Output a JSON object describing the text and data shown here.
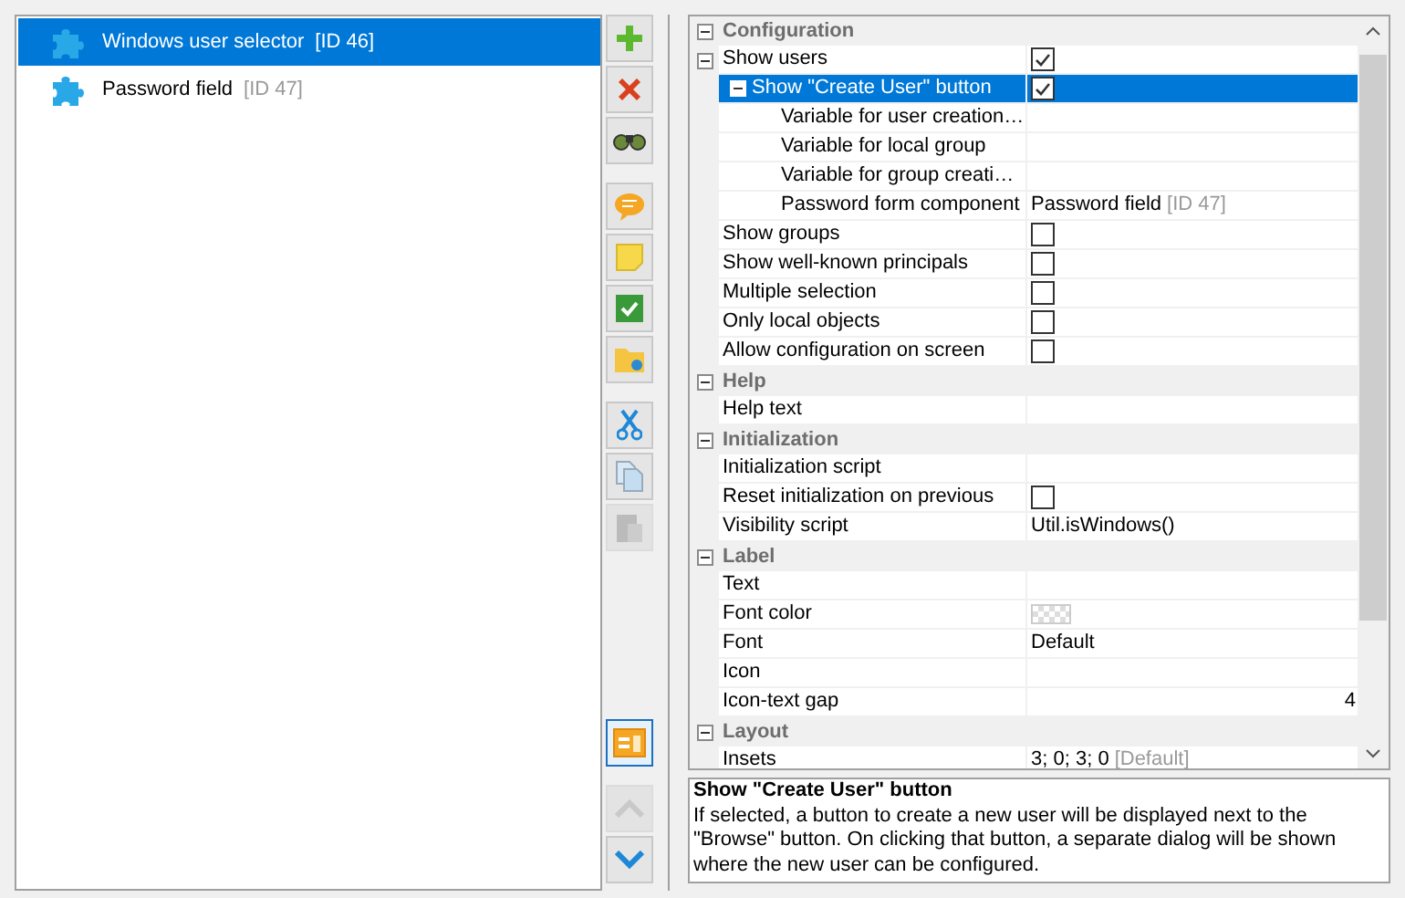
{
  "tree": [
    {
      "label": "Windows user selector",
      "id_note": "[ID 46]",
      "selected": true
    },
    {
      "label": "Password field",
      "id_note": "[ID 47]",
      "selected": false
    }
  ],
  "toolbar": [
    [
      {
        "kind": "add",
        "disabled": false,
        "pressed": false
      },
      {
        "kind": "delete",
        "disabled": false,
        "pressed": false
      },
      {
        "kind": "find",
        "disabled": false,
        "pressed": false
      }
    ],
    [
      {
        "kind": "comment",
        "disabled": false,
        "pressed": false
      },
      {
        "kind": "note",
        "disabled": false,
        "pressed": false
      },
      {
        "kind": "check",
        "disabled": false,
        "pressed": false
      },
      {
        "kind": "folder",
        "disabled": false,
        "pressed": false
      }
    ],
    [
      {
        "kind": "cut",
        "disabled": false,
        "pressed": false
      },
      {
        "kind": "copy",
        "disabled": false,
        "pressed": false
      },
      {
        "kind": "paste",
        "disabled": true,
        "pressed": false
      }
    ]
  ],
  "toolbar_bottom": [
    [
      {
        "kind": "layout",
        "disabled": false,
        "pressed": true
      }
    ],
    [
      {
        "kind": "up",
        "disabled": true,
        "pressed": false
      },
      {
        "kind": "down",
        "disabled": false,
        "pressed": false
      }
    ]
  ],
  "sections": [
    {
      "title": "Configuration",
      "expanded": true,
      "rows": [
        {
          "label": "Show users",
          "kind": "checkbox",
          "checked": true,
          "selected": false,
          "expanded": true,
          "children": [
            {
              "label": "Show \"Create User\" button",
              "kind": "checkbox",
              "checked": true,
              "selected": true,
              "expanded": true,
              "children": [
                {
                  "label": "Variable for user creation…",
                  "kind": "text",
                  "selected": false
                },
                {
                  "label": "Variable for local group",
                  "kind": "text",
                  "selected": false
                },
                {
                  "label": "Variable for group creati…",
                  "kind": "text",
                  "selected": false
                },
                {
                  "label": "Password form component",
                  "kind": "text",
                  "value": "Password field",
                  "value_note": "[ID 47]",
                  "selected": false
                }
              ]
            }
          ]
        },
        {
          "label": "Show groups",
          "kind": "checkbox",
          "checked": false,
          "selected": false
        },
        {
          "label": "Show well-known principals",
          "kind": "checkbox",
          "checked": false,
          "selected": false
        },
        {
          "label": "Multiple selection",
          "kind": "checkbox",
          "checked": false,
          "selected": false
        },
        {
          "label": "Only local objects",
          "kind": "checkbox",
          "checked": false,
          "selected": false
        },
        {
          "label": "Allow configuration on screen",
          "kind": "checkbox",
          "checked": false,
          "selected": false
        }
      ]
    },
    {
      "title": "Help",
      "expanded": true,
      "rows": [
        {
          "label": "Help text",
          "kind": "text",
          "selected": false
        }
      ]
    },
    {
      "title": "Initialization",
      "expanded": true,
      "rows": [
        {
          "label": "Initialization script",
          "kind": "text",
          "selected": false
        },
        {
          "label": "Reset initialization on previous",
          "kind": "checkbox",
          "checked": false,
          "selected": false
        },
        {
          "label": "Visibility script",
          "kind": "text",
          "value": "Util.isWindows()",
          "selected": false
        }
      ]
    },
    {
      "title": "Label",
      "expanded": true,
      "rows": [
        {
          "label": "Text",
          "kind": "text",
          "selected": false
        },
        {
          "label": "Font color",
          "kind": "color",
          "selected": false
        },
        {
          "label": "Font",
          "kind": "text",
          "value": "Default",
          "selected": false
        },
        {
          "label": "Icon",
          "kind": "text",
          "selected": false
        },
        {
          "label": "Icon-text gap",
          "kind": "number",
          "value": "4",
          "selected": false
        }
      ]
    },
    {
      "title": "Layout",
      "expanded": true,
      "rows": [
        {
          "label": "Insets",
          "kind": "text",
          "value": "3; 0; 3; 0",
          "value_note": "[Default]",
          "selected": false
        }
      ]
    }
  ],
  "description": {
    "title": "Show \"Create User\" button",
    "text": "If selected, a button to create a new user will be displayed next to the \"Browse\" button. On clicking that button, a separate dialog will be shown where the new user can be configured."
  }
}
